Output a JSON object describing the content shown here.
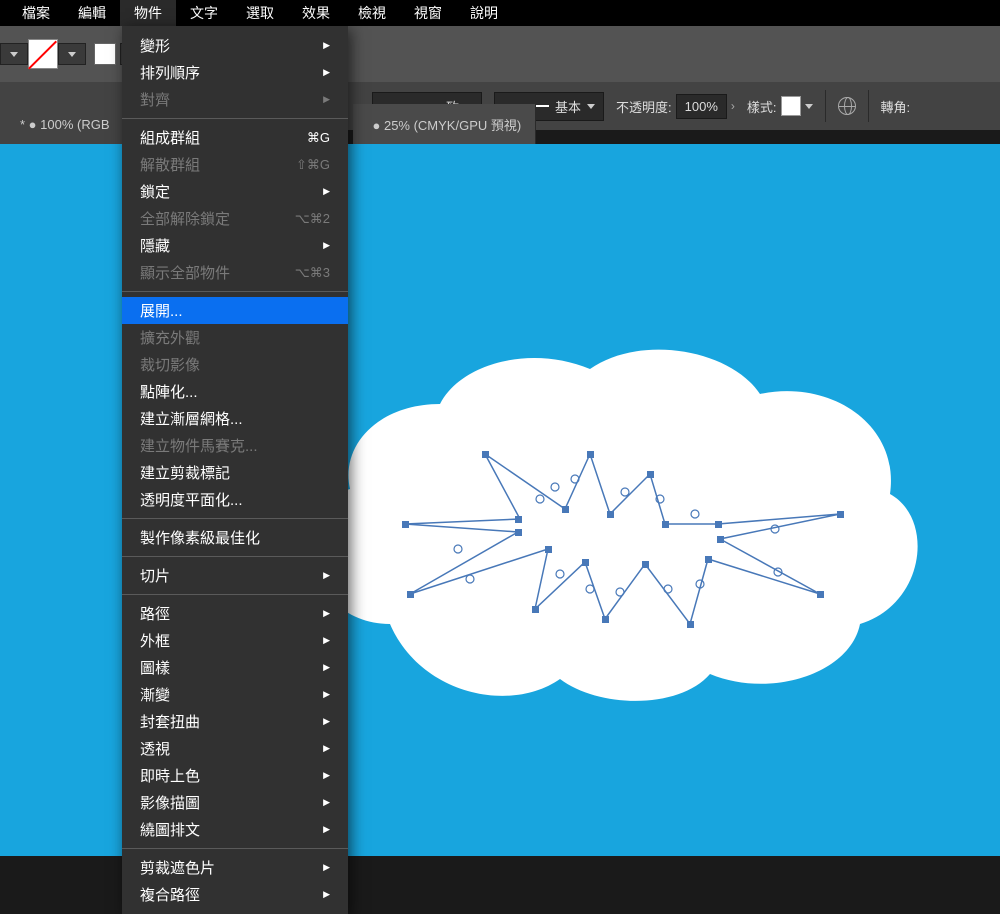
{
  "menubar": [
    "檔案",
    "編輯",
    "物件",
    "文字",
    "選取",
    "效果",
    "檢視",
    "視窗",
    "說明"
  ],
  "active_menu_index": 2,
  "toolbar": {
    "stroke_label_1": "一致",
    "stroke_label_2": "基本",
    "opacity_label": "不透明度:",
    "opacity_value": "100%",
    "style_label": "樣式:",
    "rotate_label": "轉角:"
  },
  "tabs": {
    "left": "* ● 100% (RGB",
    "right": "● 25% (CMYK/GPU 預視)"
  },
  "menu": [
    {
      "type": "item",
      "label": "變形",
      "sub": true
    },
    {
      "type": "item",
      "label": "排列順序",
      "sub": true
    },
    {
      "type": "item",
      "label": "對齊",
      "sub": true,
      "disabled": true
    },
    {
      "type": "sep"
    },
    {
      "type": "item",
      "label": "組成群組",
      "shortcut": "⌘G"
    },
    {
      "type": "item",
      "label": "解散群組",
      "shortcut": "⇧⌘G",
      "disabled": true
    },
    {
      "type": "item",
      "label": "鎖定",
      "sub": true
    },
    {
      "type": "item",
      "label": "全部解除鎖定",
      "shortcut": "⌥⌘2",
      "disabled": true
    },
    {
      "type": "item",
      "label": "隱藏",
      "sub": true
    },
    {
      "type": "item",
      "label": "顯示全部物件",
      "shortcut": "⌥⌘3",
      "disabled": true
    },
    {
      "type": "sep"
    },
    {
      "type": "item",
      "label": "展開...",
      "highlight": true
    },
    {
      "type": "item",
      "label": "擴充外觀",
      "disabled": true
    },
    {
      "type": "item",
      "label": "裁切影像",
      "disabled": true
    },
    {
      "type": "item",
      "label": "點陣化..."
    },
    {
      "type": "item",
      "label": "建立漸層網格..."
    },
    {
      "type": "item",
      "label": "建立物件馬賽克...",
      "disabled": true
    },
    {
      "type": "item",
      "label": "建立剪裁標記"
    },
    {
      "type": "item",
      "label": "透明度平面化..."
    },
    {
      "type": "sep"
    },
    {
      "type": "item",
      "label": "製作像素級最佳化"
    },
    {
      "type": "sep"
    },
    {
      "type": "item",
      "label": "切片",
      "sub": true
    },
    {
      "type": "sep"
    },
    {
      "type": "item",
      "label": "路徑",
      "sub": true
    },
    {
      "type": "item",
      "label": "外框",
      "sub": true
    },
    {
      "type": "item",
      "label": "圖樣",
      "sub": true
    },
    {
      "type": "item",
      "label": "漸變",
      "sub": true
    },
    {
      "type": "item",
      "label": "封套扭曲",
      "sub": true
    },
    {
      "type": "item",
      "label": "透視",
      "sub": true
    },
    {
      "type": "item",
      "label": "即時上色",
      "sub": true
    },
    {
      "type": "item",
      "label": "影像描圖",
      "sub": true
    },
    {
      "type": "item",
      "label": "繞圖排文",
      "sub": true
    },
    {
      "type": "sep"
    },
    {
      "type": "item",
      "label": "剪裁遮色片",
      "sub": true
    },
    {
      "type": "item",
      "label": "複合路徑",
      "sub": true
    }
  ]
}
